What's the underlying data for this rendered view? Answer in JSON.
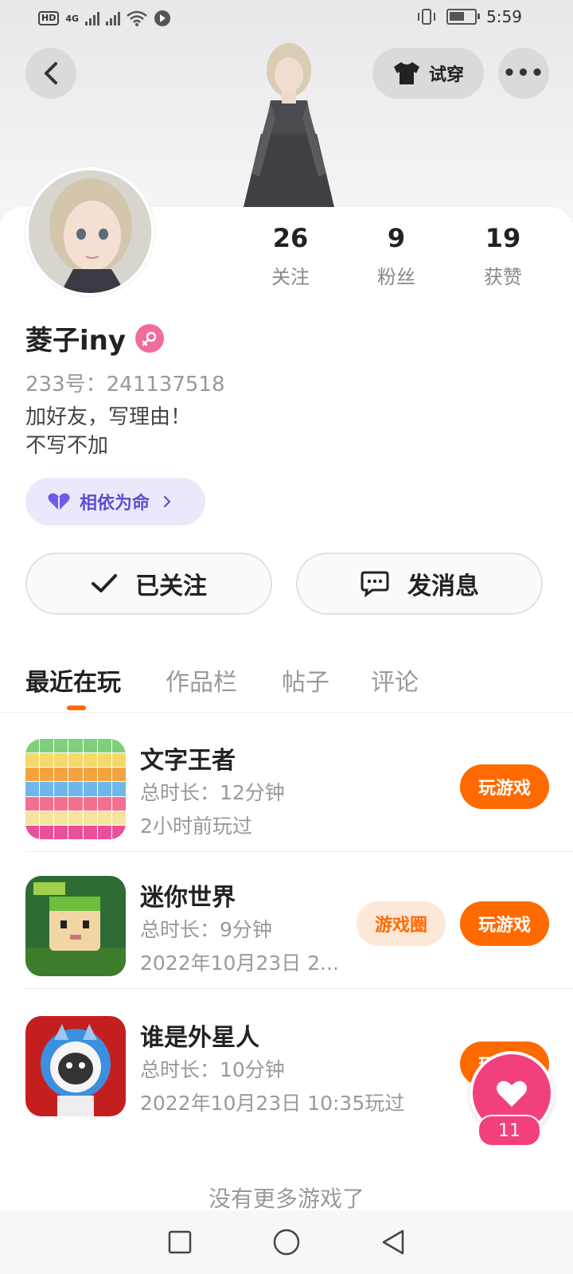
{
  "status": {
    "left": [
      "HD",
      "4G"
    ],
    "time": "5:59"
  },
  "header": {
    "try_on_label": "试穿",
    "more_label": "•••"
  },
  "stats": [
    {
      "num": "26",
      "label": "关注"
    },
    {
      "num": "9",
      "label": "粉丝"
    },
    {
      "num": "19",
      "label": "获赞"
    }
  ],
  "profile": {
    "name": "菱子iny",
    "uid": "233号：241137518",
    "bio_line1": "加好友，写理由！",
    "bio_line2": "不写不加",
    "relation_label": "相依为命"
  },
  "actions": {
    "follow_label": "已关注",
    "message_label": "发消息"
  },
  "tabs": [
    "最近在玩",
    "作品栏",
    "帖子",
    "评论"
  ],
  "games": [
    {
      "title": "文字王者",
      "duration": "总时长：12分钟",
      "last": "2小时前玩过",
      "play": "玩游戏"
    },
    {
      "title": "迷你世界",
      "duration": "总时长：9分钟",
      "last": "2022年10月23日 2...",
      "play": "玩游戏",
      "circle": "游戏圈"
    },
    {
      "title": "谁是外星人",
      "duration": "总时长：10分钟",
      "last": "2022年10月23日 10:35玩过",
      "play": "玩游戏"
    }
  ],
  "likes": {
    "count": "11"
  },
  "footer": {
    "no_more": "没有更多游戏了"
  },
  "colors": {
    "accent": "#ff6a00",
    "pink": "#f2407f",
    "relation": "#5b4fd0"
  }
}
